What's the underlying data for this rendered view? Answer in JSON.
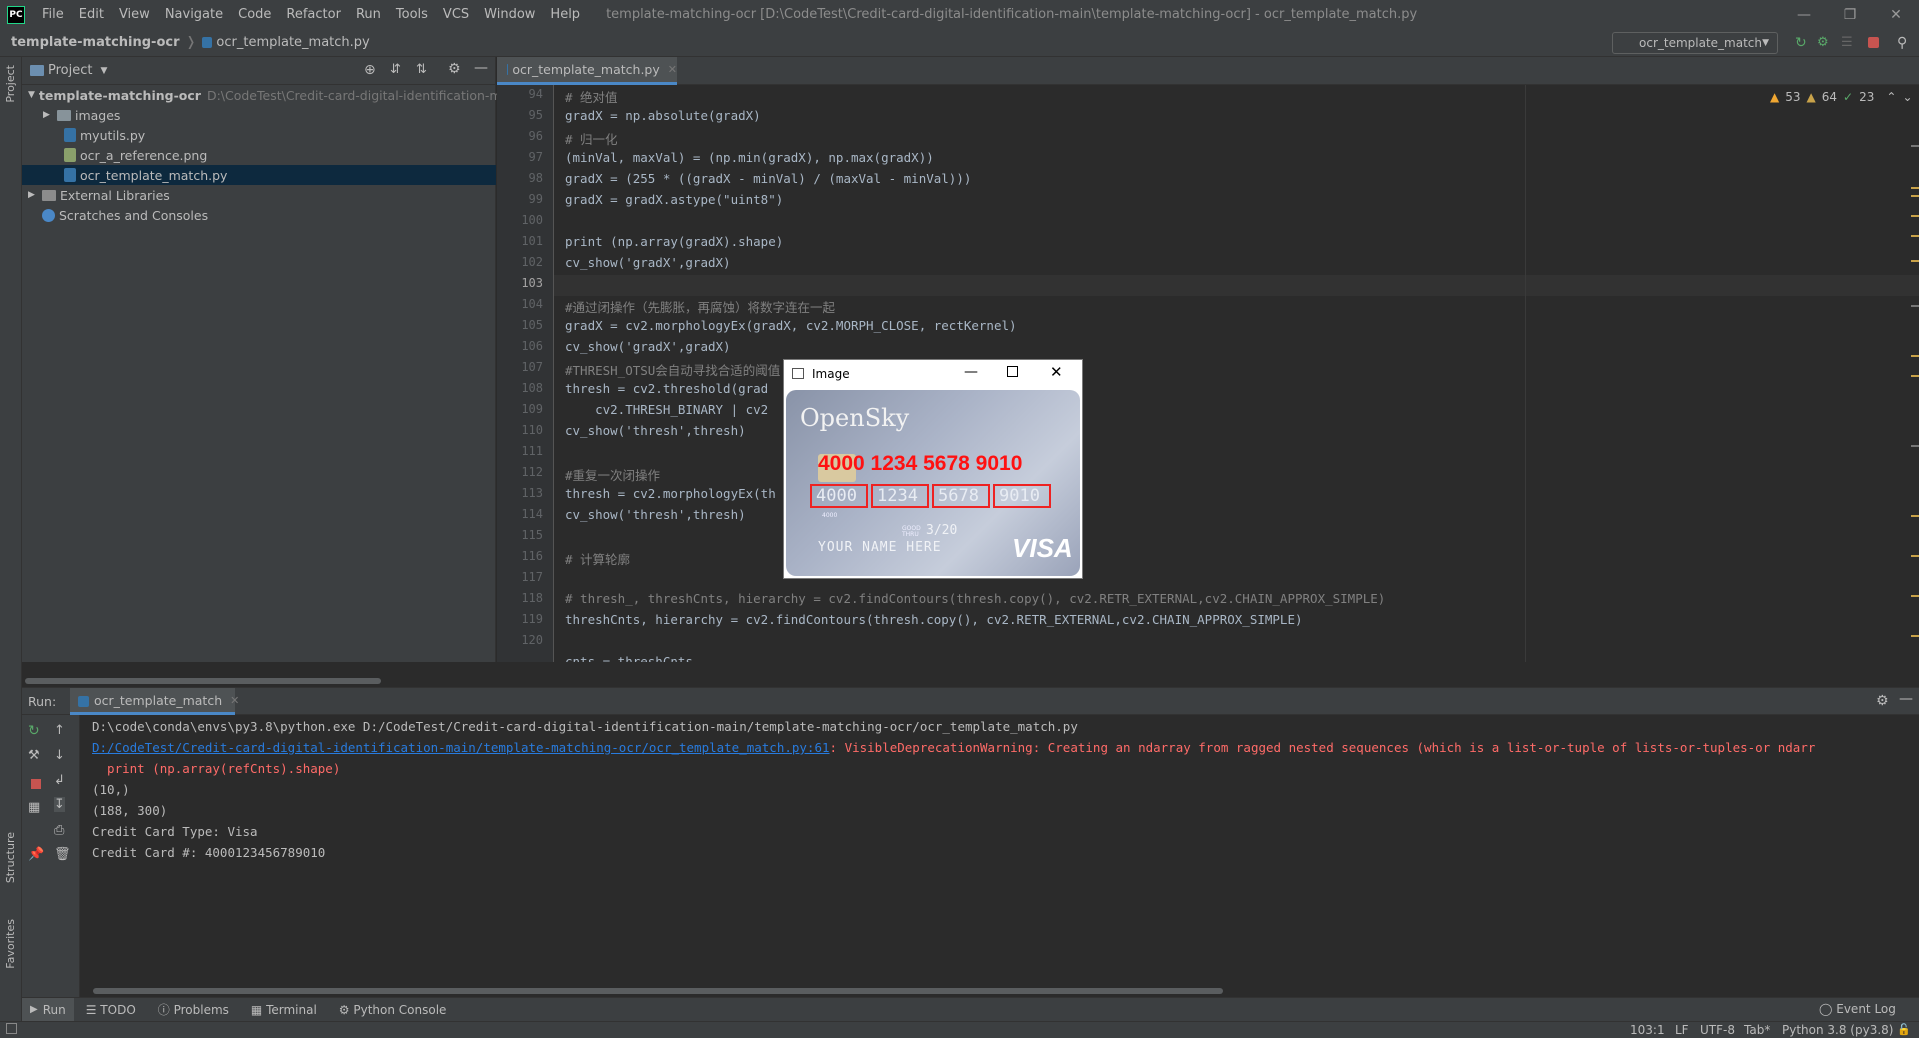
{
  "app": {
    "logo": "PC",
    "menu": [
      "File",
      "Edit",
      "View",
      "Navigate",
      "Code",
      "Refactor",
      "Run",
      "Tools",
      "VCS",
      "Window",
      "Help"
    ],
    "window_title": "template-matching-ocr [D:\\CodeTest\\Credit-card-digital-identification-main\\template-matching-ocr] - ocr_template_match.py"
  },
  "navbar": {
    "project": "template-matching-ocr",
    "file": "ocr_template_match.py",
    "run_config": "ocr_template_match"
  },
  "side_labels": {
    "project": "Project",
    "structure": "Structure",
    "favorites": "Favorites"
  },
  "project_panel": {
    "title": "Project",
    "root_name": "template-matching-ocr",
    "root_path": "D:\\CodeTest\\Credit-card-digital-identification-ma",
    "items": [
      "images",
      "myutils.py",
      "ocr_a_reference.png",
      "ocr_template_match.py",
      "External Libraries",
      "Scratches and Consoles"
    ]
  },
  "editor": {
    "tab": "ocr_template_match.py",
    "inspections": {
      "warnings": "53",
      "weak": "64",
      "ok": "23"
    },
    "line_numbers": [
      "94",
      "95",
      "96",
      "97",
      "98",
      "99",
      "100",
      "101",
      "102",
      "103",
      "104",
      "105",
      "106",
      "107",
      "108",
      "109",
      "110",
      "111",
      "112",
      "113",
      "114",
      "115",
      "116",
      "117",
      "118",
      "119",
      "120"
    ],
    "lines": [
      "# 绝对值",
      "gradX = np.absolute(gradX)",
      "# 归一化",
      "(minVal, maxVal) = (np.min(gradX), np.max(gradX))",
      "gradX = (255 * ((gradX - minVal) / (maxVal - minVal)))",
      "gradX = gradX.astype(\"uint8\")",
      "",
      "print (np.array(gradX).shape)",
      "cv_show('gradX',gradX)",
      "",
      "#通过闭操作（先膨胀，再腐蚀）将数字连在一起",
      "gradX = cv2.morphologyEx(gradX, cv2.MORPH_CLOSE, rectKernel)",
      "cv_show('gradX',gradX)",
      "#THRESH_OTSU会自动寻找合适的阈值",
      "thresh = cv2.threshold(grad",
      "    cv2.THRESH_BINARY | cv2",
      "cv_show('thresh',thresh)",
      "",
      "#重复一次闭操作",
      "thresh = cv2.morphologyEx(th",
      "cv_show('thresh',thresh)",
      "",
      "# 计算轮廓",
      "",
      "# thresh_, threshCnts, hierarchy = cv2.findContours(thresh.copy(), cv2.RETR_EXTERNAL,cv2.CHAIN_APPROX_SIMPLE)",
      "threshCnts, hierarchy = cv2.findContours(thresh.copy(), cv2.RETR_EXTERNAL,cv2.CHAIN_APPROX_SIMPLE)",
      ""
    ],
    "partial_last_line": "cnts = threshCnts"
  },
  "image_window": {
    "title": "Image",
    "card": {
      "brand": "OpenSky",
      "overlay_number": "4000 1234 5678 9010",
      "groups": [
        "4000",
        "1234",
        "5678",
        "9010"
      ],
      "small_group": "4000",
      "good_thru_label_1": "GOOD",
      "good_thru_label_2": "THRU",
      "expiry": "3/20",
      "name": "YOUR NAME HERE",
      "network": "VISA"
    }
  },
  "run_panel": {
    "label": "Run:",
    "tab": "ocr_template_match",
    "output": [
      {
        "text": "D:\\code\\conda\\envs\\py3.8\\python.exe D:/CodeTest/Credit-card-digital-identification-main/template-matching-ocr/ocr_template_match.py",
        "kind": "cmd"
      },
      {
        "text": "D:/CodeTest/Credit-card-digital-identification-main/template-matching-ocr/ocr_template_match.py:61",
        "kind": "link",
        "rest": ": VisibleDeprecationWarning: Creating an ndarray from ragged nested sequences (which is a list-or-tuple of lists-or-tuples-or ndarr"
      },
      {
        "text": "  print (np.array(refCnts).shape)",
        "kind": "err"
      },
      {
        "text": "(10,)",
        "kind": "out"
      },
      {
        "text": "(188, 300)",
        "kind": "out"
      },
      {
        "text": "Credit Card Type: Visa",
        "kind": "out"
      },
      {
        "text": "Credit Card #: 4000123456789010",
        "kind": "out"
      }
    ]
  },
  "bottom_tabs": [
    "Run",
    "TODO",
    "Problems",
    "Terminal",
    "Python Console"
  ],
  "event_log": "Event Log",
  "status": {
    "position": "103:1",
    "line_sep": "LF",
    "encoding": "UTF-8",
    "indent": "Tab*",
    "interpreter": "Python 3.8 (py3.8)"
  },
  "colors": {
    "accent": "#4a88c7",
    "error": "#ff6b68",
    "link": "#287bde",
    "string": "#6a8759",
    "comment": "#808080",
    "keyword": "#cc7832"
  }
}
